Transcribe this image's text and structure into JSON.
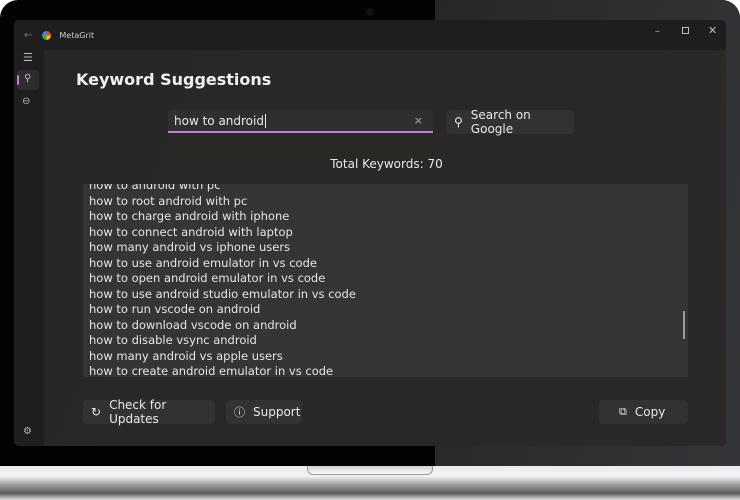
{
  "app": {
    "title": "MetaGrit"
  },
  "sidebar": {
    "items": [
      {
        "icon": "hamburger-icon"
      },
      {
        "icon": "search-icon",
        "active": true
      },
      {
        "icon": "link-icon"
      }
    ],
    "settings_icon": "gear-icon"
  },
  "main": {
    "heading": "Keyword Suggestions",
    "search": {
      "value": "how to android",
      "clear": "×"
    },
    "search_button": "Search on Google",
    "total": "Total Keywords: 70",
    "keywords": [
      "how to android with pc",
      "how to root android with pc",
      "how to charge android with iphone",
      "how to connect android with laptop",
      "how many android vs iphone users",
      "how to use android emulator in vs code",
      "how to open android emulator in vs code",
      "how to use android studio emulator in vs code",
      "how to run vscode on android",
      "how to download vscode on android",
      "how to disable vsync android",
      "how many android vs apple users",
      "how to create android emulator in vs code"
    ],
    "buttons": {
      "updates": "Check for Updates",
      "support": "Support",
      "copy": "Copy"
    }
  },
  "colors": {
    "accent": "#c77dd7"
  }
}
